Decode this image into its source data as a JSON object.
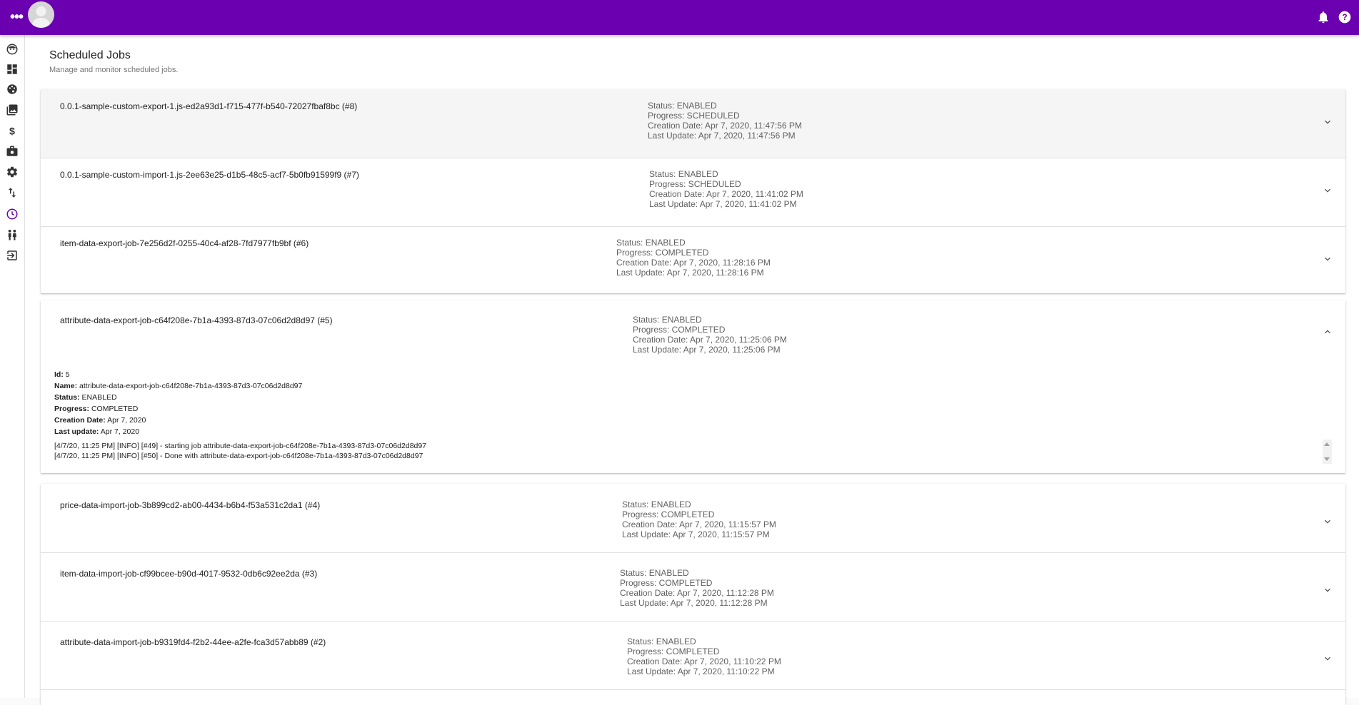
{
  "colors": {
    "topbar": "#6a00b0",
    "accent": "#6a00b0",
    "text_muted": "#616161"
  },
  "topbar": {
    "menu_icon": "more-horizontal-icon",
    "avatar_icon": "user-avatar-icon",
    "notifications_icon": "bell-icon",
    "help_icon": "help-circle-icon"
  },
  "sidebar": {
    "items": [
      {
        "icon": "face-icon"
      },
      {
        "icon": "dashboard-icon"
      },
      {
        "icon": "palette-icon"
      },
      {
        "icon": "photo-library-icon"
      },
      {
        "icon": "dollar-icon"
      },
      {
        "icon": "work-icon"
      },
      {
        "icon": "gear-icon"
      },
      {
        "icon": "import-export-icon"
      },
      {
        "icon": "clock-icon",
        "active": true
      },
      {
        "icon": "people-icon"
      },
      {
        "icon": "logout-icon"
      }
    ]
  },
  "page": {
    "title": "Scheduled Jobs",
    "subtitle": "Manage and monitor scheduled jobs."
  },
  "group1": [
    {
      "name": "0.0.1-sample-custom-export-1.js-ed2a93d1-f715-477f-b540-72027fbaf8bc (#8)",
      "status": "Status: ENABLED",
      "progress": "Progress: SCHEDULED",
      "created": "Creation Date: Apr 7, 2020, 11:47:56 PM",
      "updated": "Last Update: Apr 7, 2020, 11:47:56 PM"
    },
    {
      "name": "0.0.1-sample-custom-import-1.js-2ee63e25-d1b5-48c5-acf7-5b0fb91599f9 (#7)",
      "status": "Status: ENABLED",
      "progress": "Progress: SCHEDULED",
      "created": "Creation Date: Apr 7, 2020, 11:41:02 PM",
      "updated": "Last Update: Apr 7, 2020, 11:41:02 PM"
    },
    {
      "name": "item-data-export-job-7e256d2f-0255-40c4-af28-7fd7977fb9bf (#6)",
      "status": "Status: ENABLED",
      "progress": "Progress: COMPLETED",
      "created": "Creation Date: Apr 7, 2020, 11:28:16 PM",
      "updated": "Last Update: Apr 7, 2020, 11:28:16 PM"
    }
  ],
  "expanded": {
    "name": "attribute-data-export-job-c64f208e-7b1a-4393-87d3-07c06d2d8d97 (#5)",
    "status": "Status: ENABLED",
    "progress": "Progress: COMPLETED",
    "created": "Creation Date: Apr 7, 2020, 11:25:06 PM",
    "updated": "Last Update: Apr 7, 2020, 11:25:06 PM",
    "details": {
      "id_label": "Id:",
      "id": "5",
      "name_label": "Name:",
      "name": "attribute-data-export-job-c64f208e-7b1a-4393-87d3-07c06d2d8d97",
      "status_label": "Status:",
      "status": "ENABLED",
      "progress_label": "Progress:",
      "progress": "COMPLETED",
      "created_label": "Creation Date:",
      "created": "Apr 7, 2020",
      "updated_label": "Last update:",
      "updated": "Apr 7, 2020"
    },
    "log": [
      "[4/7/20, 11:25 PM] [INFO] [#49] - starting job attribute-data-export-job-c64f208e-7b1a-4393-87d3-07c06d2d8d97",
      "[4/7/20, 11:25 PM] [INFO] [#50] - Done with attribute-data-export-job-c64f208e-7b1a-4393-87d3-07c06d2d8d97"
    ]
  },
  "group2": [
    {
      "name": "price-data-import-job-3b899cd2-ab00-4434-b6b4-f53a531c2da1 (#4)",
      "status": "Status: ENABLED",
      "progress": "Progress: COMPLETED",
      "created": "Creation Date: Apr 7, 2020, 11:15:57 PM",
      "updated": "Last Update: Apr 7, 2020, 11:15:57 PM"
    },
    {
      "name": "item-data-import-job-cf99bcee-b90d-4017-9532-0db6c92ee2da (#3)",
      "status": "Status: ENABLED",
      "progress": "Progress: COMPLETED",
      "created": "Creation Date: Apr 7, 2020, 11:12:28 PM",
      "updated": "Last Update: Apr 7, 2020, 11:12:28 PM"
    },
    {
      "name": "attribute-data-import-job-b9319fd4-f2b2-44ee-a2fe-fca3d57abb89 (#2)",
      "status": "Status: ENABLED",
      "progress": "Progress: COMPLETED",
      "created": "Creation Date: Apr 7, 2020, 11:10:22 PM",
      "updated": "Last Update: Apr 7, 2020, 11:10:22 PM"
    }
  ]
}
